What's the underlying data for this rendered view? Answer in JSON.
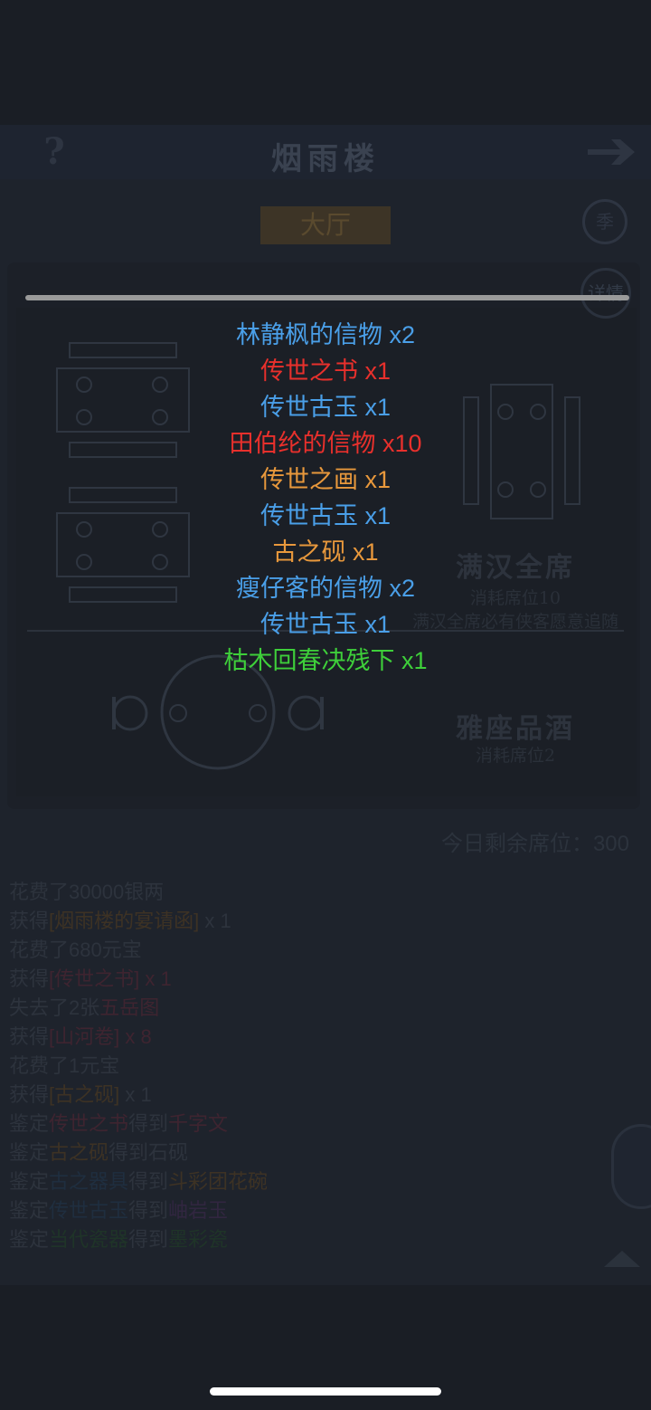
{
  "header": {
    "title": "烟雨楼",
    "help_icon": "?",
    "next_icon": "arrow-right-icon"
  },
  "tab": {
    "label": "大厅"
  },
  "side_icons": {
    "icon1": "季",
    "icon2_label": "详情"
  },
  "options": [
    {
      "title": "满汉全席",
      "cost": "消耗席位10",
      "desc": "满汉全席必有侠客愿意追随"
    },
    {
      "title": "雅座品酒",
      "cost": "消耗席位2"
    }
  ],
  "remaining_seats": "今日剩余席位：300",
  "log": [
    {
      "parts": [
        {
          "text": "花费了30000银两",
          "style": ""
        }
      ]
    },
    {
      "parts": [
        {
          "text": "获得",
          "style": ""
        },
        {
          "text": "[烟雨楼的宴请函]",
          "style": "hl-orange"
        },
        {
          "text": " x 1",
          "style": ""
        }
      ]
    },
    {
      "parts": [
        {
          "text": "花费了680元宝",
          "style": ""
        }
      ]
    },
    {
      "parts": [
        {
          "text": "获得",
          "style": ""
        },
        {
          "text": "[传世之书]",
          "style": "hl-red"
        },
        {
          "text": " x 1",
          "style": "hl-red"
        }
      ]
    },
    {
      "parts": [
        {
          "text": "失去了2张",
          "style": ""
        },
        {
          "text": "五岳图",
          "style": "hl-red"
        }
      ]
    },
    {
      "parts": [
        {
          "text": "获得",
          "style": ""
        },
        {
          "text": "[山河卷]",
          "style": "hl-red"
        },
        {
          "text": " x 8",
          "style": "hl-red"
        }
      ]
    },
    {
      "parts": [
        {
          "text": "花费了1元宝",
          "style": ""
        }
      ]
    },
    {
      "parts": [
        {
          "text": "获得",
          "style": ""
        },
        {
          "text": "[古之砚]",
          "style": "hl-orange"
        },
        {
          "text": " x 1",
          "style": ""
        }
      ]
    },
    {
      "parts": [
        {
          "text": "鉴定",
          "style": ""
        },
        {
          "text": "传世之书",
          "style": "hl-red"
        },
        {
          "text": "得到",
          "style": ""
        },
        {
          "text": "千字文",
          "style": "hl-red"
        }
      ]
    },
    {
      "parts": [
        {
          "text": "鉴定",
          "style": ""
        },
        {
          "text": "古之砚",
          "style": "hl-orange"
        },
        {
          "text": "得到石砚",
          "style": ""
        }
      ]
    },
    {
      "parts": [
        {
          "text": "鉴定",
          "style": ""
        },
        {
          "text": "古之器具",
          "style": "hl-blue"
        },
        {
          "text": "得到",
          "style": ""
        },
        {
          "text": "斗彩团花碗",
          "style": "hl-orange"
        }
      ]
    },
    {
      "parts": [
        {
          "text": "鉴定",
          "style": ""
        },
        {
          "text": "传世古玉",
          "style": "hl-blue"
        },
        {
          "text": "得到",
          "style": ""
        },
        {
          "text": "岫岩玉",
          "style": "hl-purple"
        }
      ]
    },
    {
      "parts": [
        {
          "text": "鉴定",
          "style": ""
        },
        {
          "text": "当代瓷器",
          "style": "hl-green"
        },
        {
          "text": "得到",
          "style": ""
        },
        {
          "text": "墨彩瓷",
          "style": "hl-green"
        }
      ]
    }
  ],
  "rewards": [
    {
      "text": "林静枫的信物 x2",
      "color": "#4a9fe8"
    },
    {
      "text": "传世之书 x1",
      "color": "#e8302c"
    },
    {
      "text": "传世古玉 x1",
      "color": "#4a9fe8"
    },
    {
      "text": "田伯纶的信物 x10",
      "color": "#e8302c"
    },
    {
      "text": "传世之画 x1",
      "color": "#e8983c"
    },
    {
      "text": "传世古玉 x1",
      "color": "#4a9fe8"
    },
    {
      "text": "古之砚 x1",
      "color": "#e8983c"
    },
    {
      "text": "瘦仔客的信物 x2",
      "color": "#4a9fe8"
    },
    {
      "text": "传世古玉 x1",
      "color": "#4a9fe8"
    },
    {
      "text": "枯木回春决残下 x1",
      "color": "#3ecf3a"
    }
  ]
}
